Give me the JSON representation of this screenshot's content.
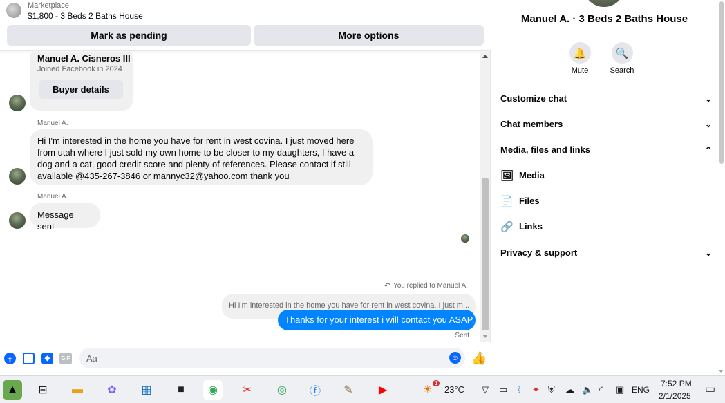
{
  "header": {
    "marketplace_label": "Marketplace",
    "listing_title": "$1,800 - 3 Beds 2 Baths House",
    "mark_pending": "Mark as pending",
    "more_options": "More options"
  },
  "buyer_card": {
    "name": "Manuel A. Cisneros III",
    "joined": "Joined Facebook in 2024",
    "button": "Buyer details"
  },
  "messages": [
    {
      "sender": "Manuel A.",
      "text": "Hi I'm interested in the home you have for rent in west covina. I just moved here from utah where I just sold my own home to be closer to my daughters, I have a dog and a cat, good credit score and plenty of references. Please contact if still available @435-267-3846 or mannyc32@yahoo.com thank you"
    },
    {
      "sender": "Manuel A.",
      "text": "Message sent"
    }
  ],
  "reply": {
    "replied_label": "You replied to Manuel A.",
    "quoted": "Hi I'm interested in the home you have for rent in west covina. I just m...",
    "sent_text": "Thanks for your interest i will contact you ASAP.",
    "status": "Sent"
  },
  "composer": {
    "placeholder": "Aa",
    "gif_label": "GIF"
  },
  "panel": {
    "title": "Manuel A. · 3 Beds 2 Baths House",
    "actions": [
      {
        "label": "Mute",
        "icon": "bell-icon"
      },
      {
        "label": "Search",
        "icon": "search-icon"
      }
    ],
    "sections": {
      "customize": "Customize chat",
      "members": "Chat members",
      "media_files_links": "Media, files and links",
      "media": "Media",
      "files": "Files",
      "links": "Links",
      "privacy": "Privacy & support"
    }
  },
  "taskbar": {
    "temperature": "23°C",
    "weather_badge": "1",
    "language": "ENG",
    "time": "7:52 PM",
    "date": "2/1/2025"
  },
  "colors": {
    "accent": "#0084ff",
    "bubble_gray": "#f0f0f0",
    "button_gray": "#e4e6eb"
  }
}
